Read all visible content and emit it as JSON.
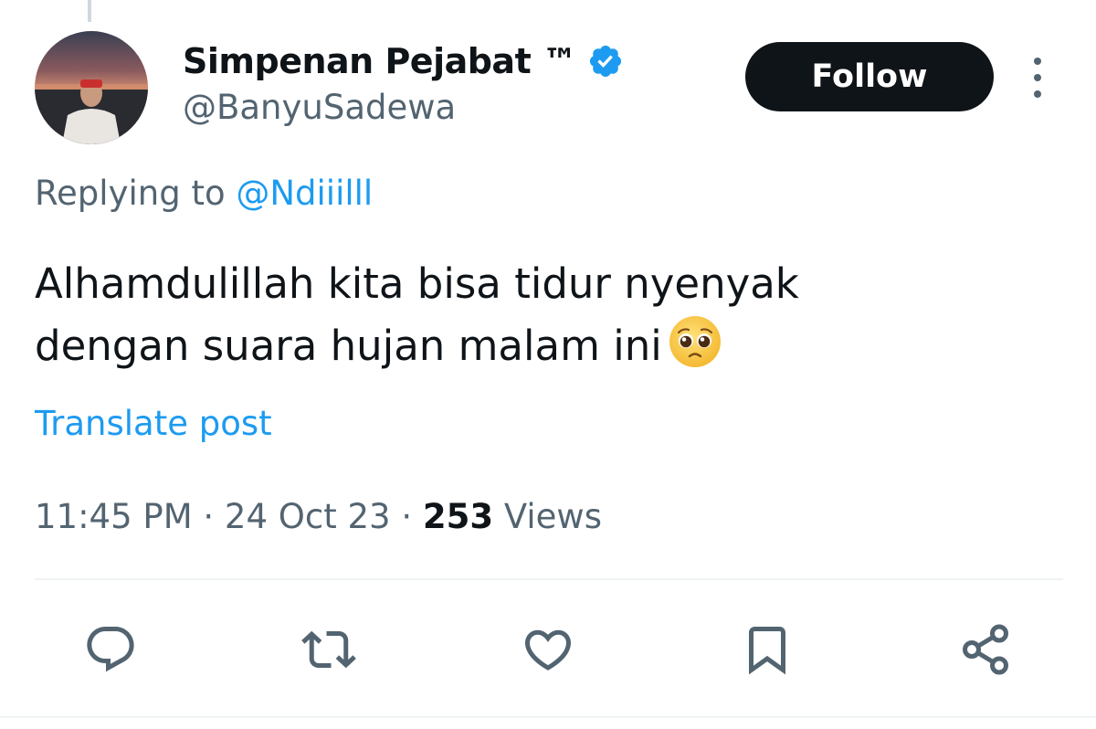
{
  "profile": {
    "display_name": "Simpenan Pejabat ™",
    "handle": "@BanyuSadewa",
    "verified_icon": "verified-badge-icon",
    "avatar_icon": "profile-photo-sunset"
  },
  "header": {
    "follow_label": "Follow",
    "more_icon": "more-vertical-icon"
  },
  "reply": {
    "prefix": "Replying to ",
    "mention": "@Ndiiilll"
  },
  "post": {
    "line1": "Alhamdulillah kita bisa tidur nyenyak",
    "line2": "dengan suara hujan malam ini",
    "emoji": "pleading-face-emoji",
    "translate_label": "Translate post"
  },
  "meta": {
    "time": "11:45 PM",
    "separator": " · ",
    "date": "24 Oct 23",
    "views_count": "253",
    "views_label": " Views"
  },
  "actions": [
    {
      "name": "reply",
      "icon": "reply-icon"
    },
    {
      "name": "repost",
      "icon": "repost-icon"
    },
    {
      "name": "like",
      "icon": "heart-icon"
    },
    {
      "name": "bookmark",
      "icon": "bookmark-icon"
    },
    {
      "name": "share",
      "icon": "share-icon"
    }
  ],
  "colors": {
    "text_primary": "#0f1419",
    "text_secondary": "#536471",
    "link": "#1d9bf0",
    "verified": "#1d9bf0",
    "follow_bg": "#0f1419",
    "follow_text": "#ffffff",
    "divider": "#eff3f4"
  }
}
